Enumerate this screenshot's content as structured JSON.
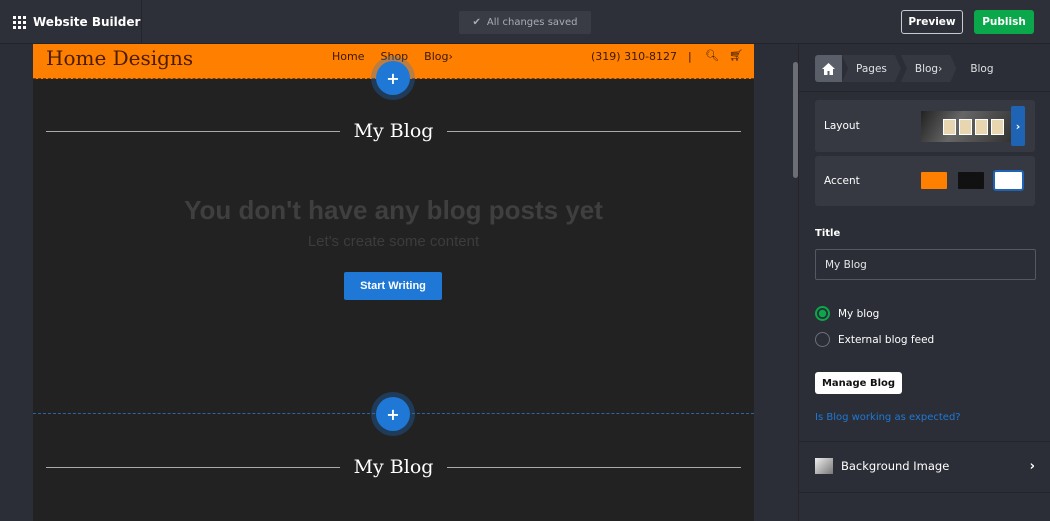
{
  "app": {
    "title": "Website Builder",
    "save_status": "All changes saved",
    "preview_label": "Preview",
    "publish_label": "Publish"
  },
  "site": {
    "logo": "Home Designs",
    "nav": [
      "Home",
      "Shop",
      "Blog›"
    ],
    "phone": "(319) 310-8127",
    "separator": "|",
    "header_color": "#ff8000"
  },
  "canvas": {
    "add_section_label": "+",
    "sections": [
      {
        "title": "My Blog",
        "empty_heading": "You don't have any blog posts yet",
        "empty_sub": "Let's create some content",
        "cta": "Start Writing"
      },
      {
        "title": "My Blog"
      }
    ]
  },
  "panel": {
    "breadcrumb": [
      "Pages",
      "Blog›",
      "Blog"
    ],
    "layout_label": "Layout",
    "accent_label": "Accent",
    "accent_colors": [
      "#ff8000",
      "#111111",
      "#ffffff"
    ],
    "accent_selected": 2,
    "title_label": "Title",
    "title_value": "My Blog",
    "source_options": [
      "My blog",
      "External blog feed"
    ],
    "source_selected": 0,
    "manage_label": "Manage Blog",
    "help_link": "Is Blog working as expected?",
    "background_label": "Background Image"
  },
  "colors": {
    "accent_blue": "#1f78d6",
    "publish_green": "#0aa84a"
  }
}
